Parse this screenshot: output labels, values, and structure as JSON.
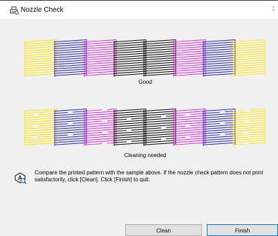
{
  "window": {
    "title": "Nozzle Check",
    "close_glyph": ":"
  },
  "good_pattern": {
    "caption": "Good",
    "colors": [
      "#ffe800",
      "#2222c8",
      "#e020e0",
      "#000000",
      "#000000",
      "#e020e0",
      "#2222c8",
      "#ffe800"
    ]
  },
  "bad_pattern": {
    "caption": "Cleaning needed",
    "colors": [
      "#ffe800",
      "#2222c8",
      "#e020e0",
      "#000000",
      "#000000",
      "#e020e0",
      "#2222c8",
      "#ffe800"
    ]
  },
  "instructions": {
    "line1": "Compare the printed pattern with the sample above. If the nozzle check pattern does not print",
    "line2": "satisfactorily, click [Clean]. Click [Finish] to quit."
  },
  "buttons": {
    "clean": "Clean",
    "finish": "Finish"
  },
  "icons": {
    "title_icon": "printer-check-icon",
    "info_icon": "printer-magnify-icon"
  }
}
